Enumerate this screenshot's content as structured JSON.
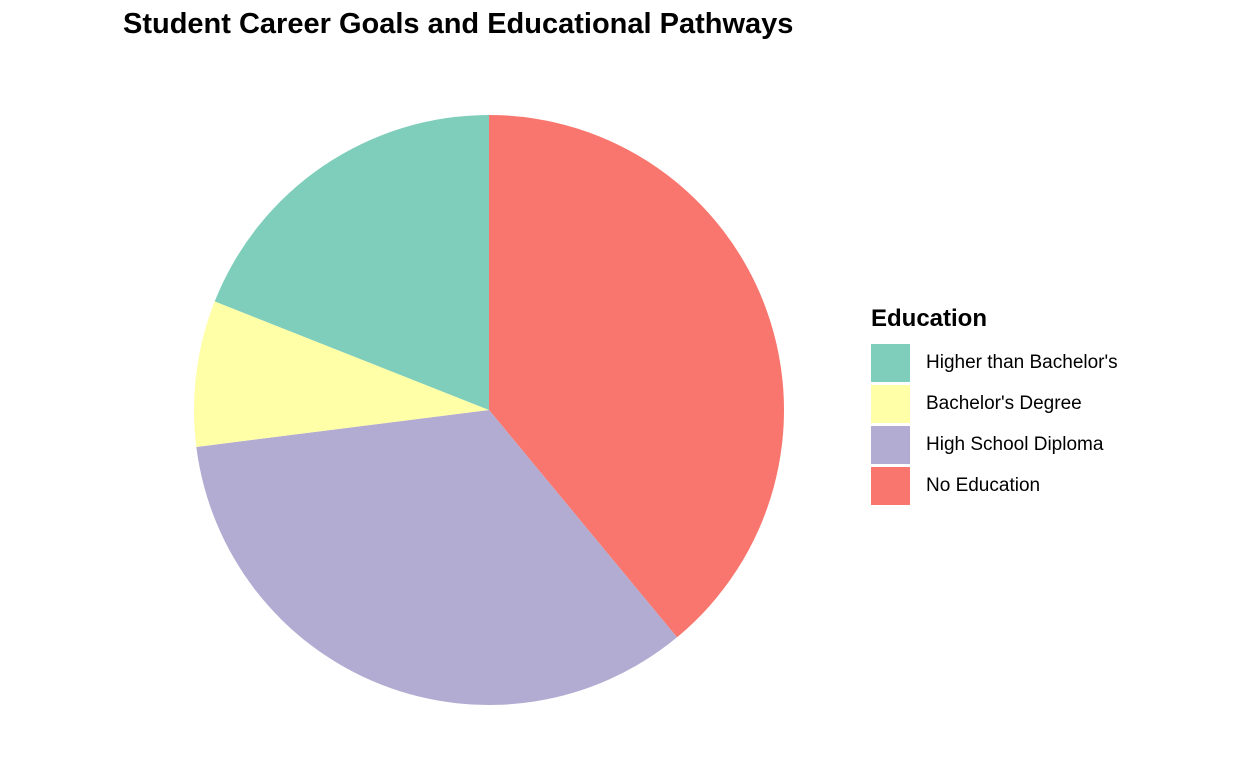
{
  "chart_data": {
    "type": "pie",
    "title": "Student Career Goals and Educational Pathways",
    "legend_title": "Education",
    "legend_position": "right",
    "slice_order": "clockwise from top",
    "slices": [
      {
        "label": "No Education",
        "value": 39,
        "color": "#F8766D"
      },
      {
        "label": "High School Diploma",
        "value": 34,
        "color": "#B2ABD2"
      },
      {
        "label": "Bachelor's Degree",
        "value": 8,
        "color": "#FFFFA8"
      },
      {
        "label": "Higher than Bachelor's",
        "value": 19,
        "color": "#7FCDBB"
      }
    ],
    "legend_order": [
      "Higher than Bachelor's",
      "Bachelor's Degree",
      "High School Diploma",
      "No Education"
    ]
  }
}
